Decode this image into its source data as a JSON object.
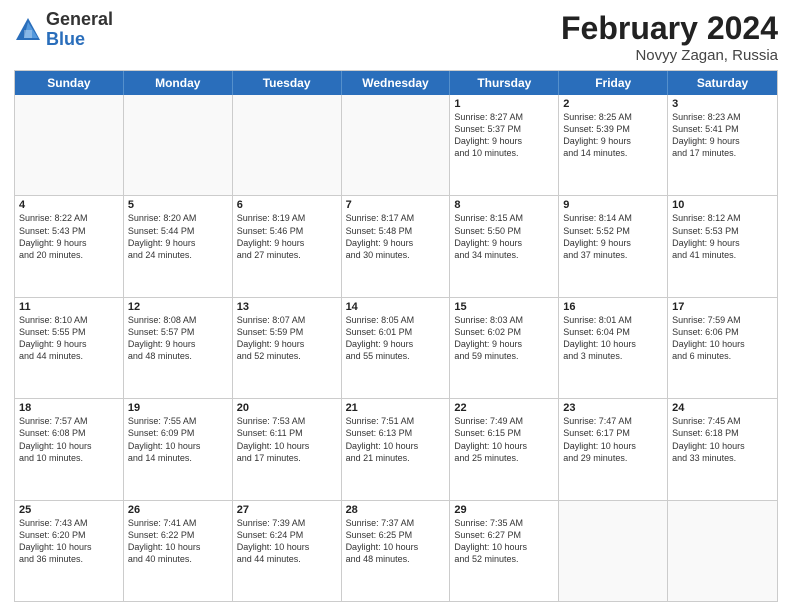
{
  "logo": {
    "general": "General",
    "blue": "Blue"
  },
  "title": {
    "month": "February 2024",
    "location": "Novyy Zagan, Russia"
  },
  "header_days": [
    "Sunday",
    "Monday",
    "Tuesday",
    "Wednesday",
    "Thursday",
    "Friday",
    "Saturday"
  ],
  "weeks": [
    [
      {
        "day": "",
        "info": ""
      },
      {
        "day": "",
        "info": ""
      },
      {
        "day": "",
        "info": ""
      },
      {
        "day": "",
        "info": ""
      },
      {
        "day": "1",
        "info": "Sunrise: 8:27 AM\nSunset: 5:37 PM\nDaylight: 9 hours\nand 10 minutes."
      },
      {
        "day": "2",
        "info": "Sunrise: 8:25 AM\nSunset: 5:39 PM\nDaylight: 9 hours\nand 14 minutes."
      },
      {
        "day": "3",
        "info": "Sunrise: 8:23 AM\nSunset: 5:41 PM\nDaylight: 9 hours\nand 17 minutes."
      }
    ],
    [
      {
        "day": "4",
        "info": "Sunrise: 8:22 AM\nSunset: 5:43 PM\nDaylight: 9 hours\nand 20 minutes."
      },
      {
        "day": "5",
        "info": "Sunrise: 8:20 AM\nSunset: 5:44 PM\nDaylight: 9 hours\nand 24 minutes."
      },
      {
        "day": "6",
        "info": "Sunrise: 8:19 AM\nSunset: 5:46 PM\nDaylight: 9 hours\nand 27 minutes."
      },
      {
        "day": "7",
        "info": "Sunrise: 8:17 AM\nSunset: 5:48 PM\nDaylight: 9 hours\nand 30 minutes."
      },
      {
        "day": "8",
        "info": "Sunrise: 8:15 AM\nSunset: 5:50 PM\nDaylight: 9 hours\nand 34 minutes."
      },
      {
        "day": "9",
        "info": "Sunrise: 8:14 AM\nSunset: 5:52 PM\nDaylight: 9 hours\nand 37 minutes."
      },
      {
        "day": "10",
        "info": "Sunrise: 8:12 AM\nSunset: 5:53 PM\nDaylight: 9 hours\nand 41 minutes."
      }
    ],
    [
      {
        "day": "11",
        "info": "Sunrise: 8:10 AM\nSunset: 5:55 PM\nDaylight: 9 hours\nand 44 minutes."
      },
      {
        "day": "12",
        "info": "Sunrise: 8:08 AM\nSunset: 5:57 PM\nDaylight: 9 hours\nand 48 minutes."
      },
      {
        "day": "13",
        "info": "Sunrise: 8:07 AM\nSunset: 5:59 PM\nDaylight: 9 hours\nand 52 minutes."
      },
      {
        "day": "14",
        "info": "Sunrise: 8:05 AM\nSunset: 6:01 PM\nDaylight: 9 hours\nand 55 minutes."
      },
      {
        "day": "15",
        "info": "Sunrise: 8:03 AM\nSunset: 6:02 PM\nDaylight: 9 hours\nand 59 minutes."
      },
      {
        "day": "16",
        "info": "Sunrise: 8:01 AM\nSunset: 6:04 PM\nDaylight: 10 hours\nand 3 minutes."
      },
      {
        "day": "17",
        "info": "Sunrise: 7:59 AM\nSunset: 6:06 PM\nDaylight: 10 hours\nand 6 minutes."
      }
    ],
    [
      {
        "day": "18",
        "info": "Sunrise: 7:57 AM\nSunset: 6:08 PM\nDaylight: 10 hours\nand 10 minutes."
      },
      {
        "day": "19",
        "info": "Sunrise: 7:55 AM\nSunset: 6:09 PM\nDaylight: 10 hours\nand 14 minutes."
      },
      {
        "day": "20",
        "info": "Sunrise: 7:53 AM\nSunset: 6:11 PM\nDaylight: 10 hours\nand 17 minutes."
      },
      {
        "day": "21",
        "info": "Sunrise: 7:51 AM\nSunset: 6:13 PM\nDaylight: 10 hours\nand 21 minutes."
      },
      {
        "day": "22",
        "info": "Sunrise: 7:49 AM\nSunset: 6:15 PM\nDaylight: 10 hours\nand 25 minutes."
      },
      {
        "day": "23",
        "info": "Sunrise: 7:47 AM\nSunset: 6:17 PM\nDaylight: 10 hours\nand 29 minutes."
      },
      {
        "day": "24",
        "info": "Sunrise: 7:45 AM\nSunset: 6:18 PM\nDaylight: 10 hours\nand 33 minutes."
      }
    ],
    [
      {
        "day": "25",
        "info": "Sunrise: 7:43 AM\nSunset: 6:20 PM\nDaylight: 10 hours\nand 36 minutes."
      },
      {
        "day": "26",
        "info": "Sunrise: 7:41 AM\nSunset: 6:22 PM\nDaylight: 10 hours\nand 40 minutes."
      },
      {
        "day": "27",
        "info": "Sunrise: 7:39 AM\nSunset: 6:24 PM\nDaylight: 10 hours\nand 44 minutes."
      },
      {
        "day": "28",
        "info": "Sunrise: 7:37 AM\nSunset: 6:25 PM\nDaylight: 10 hours\nand 48 minutes."
      },
      {
        "day": "29",
        "info": "Sunrise: 7:35 AM\nSunset: 6:27 PM\nDaylight: 10 hours\nand 52 minutes."
      },
      {
        "day": "",
        "info": ""
      },
      {
        "day": "",
        "info": ""
      }
    ]
  ]
}
